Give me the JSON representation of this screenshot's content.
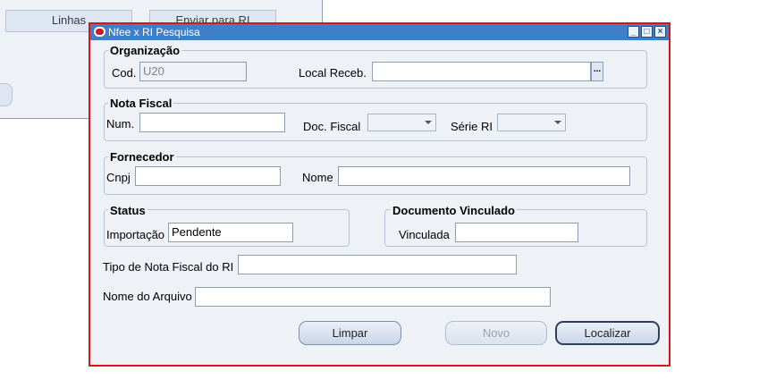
{
  "background": {
    "linhas_label": "Linhas",
    "enviar_label": "Enviar para RI"
  },
  "dialog": {
    "title": "Nfee x RI Pesquisa",
    "organizacao": {
      "title": "Organização",
      "cod_label": "Cod.",
      "cod_value": "U20",
      "local_label": "Local Receb.",
      "local_value": "",
      "lov_label": "..."
    },
    "nota_fiscal": {
      "title": "Nota Fiscal",
      "num_label": "Num.",
      "num_value": "",
      "doc_label": "Doc. Fiscal",
      "doc_value": "",
      "serie_label": "Série RI",
      "serie_value": ""
    },
    "fornecedor": {
      "title": "Fornecedor",
      "cnpj_label": "Cnpj",
      "cnpj_value": "",
      "nome_label": "Nome",
      "nome_value": ""
    },
    "status": {
      "title": "Status",
      "importacao_label": "Importação",
      "importacao_value": "Pendente"
    },
    "documento_vinculado": {
      "title": "Documento Vinculado",
      "vinculada_label": "Vinculada",
      "vinculada_value": ""
    },
    "tipo_nota_label": "Tipo de Nota Fiscal do RI",
    "tipo_nota_value": "",
    "nome_arquivo_label": "Nome do Arquivo",
    "nome_arquivo_value": "",
    "buttons": {
      "limpar": "Limpar",
      "novo": "Novo",
      "localizar": "Localizar"
    }
  }
}
